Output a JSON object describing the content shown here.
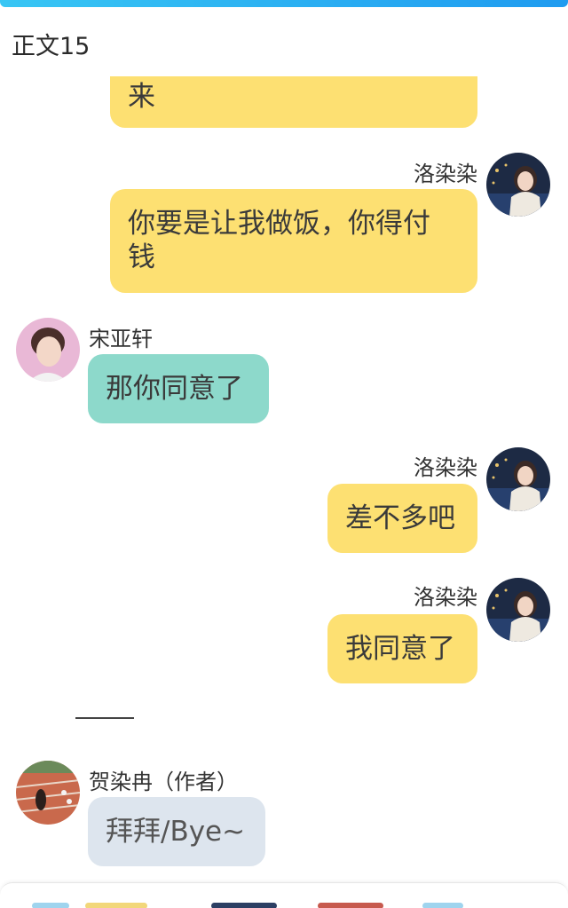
{
  "chapter_title": "正文15",
  "messages": [
    {
      "speaker": "",
      "text": "来",
      "style": "yellow"
    },
    {
      "speaker": "洛染染",
      "text": "你要是让我做饭，你得付钱",
      "line1": "你要是让我做饭，你得付",
      "line2": "钱",
      "style": "yellow"
    },
    {
      "speaker": "宋亚轩",
      "text": "那你同意了",
      "style": "teal"
    },
    {
      "speaker": "洛染染",
      "text": "差不多吧",
      "style": "yellow"
    },
    {
      "speaker": "洛染染",
      "text": "我同意了",
      "style": "yellow"
    },
    {
      "speaker": "贺染冉（作者）",
      "text": "拜拜/Bye~",
      "style": "grey"
    }
  ],
  "colors": {
    "yellow_bubble": "#fde072",
    "teal_bubble": "#8dd9cb",
    "grey_bubble": "#dde5ee",
    "top_bar": "#1f9bf0"
  }
}
